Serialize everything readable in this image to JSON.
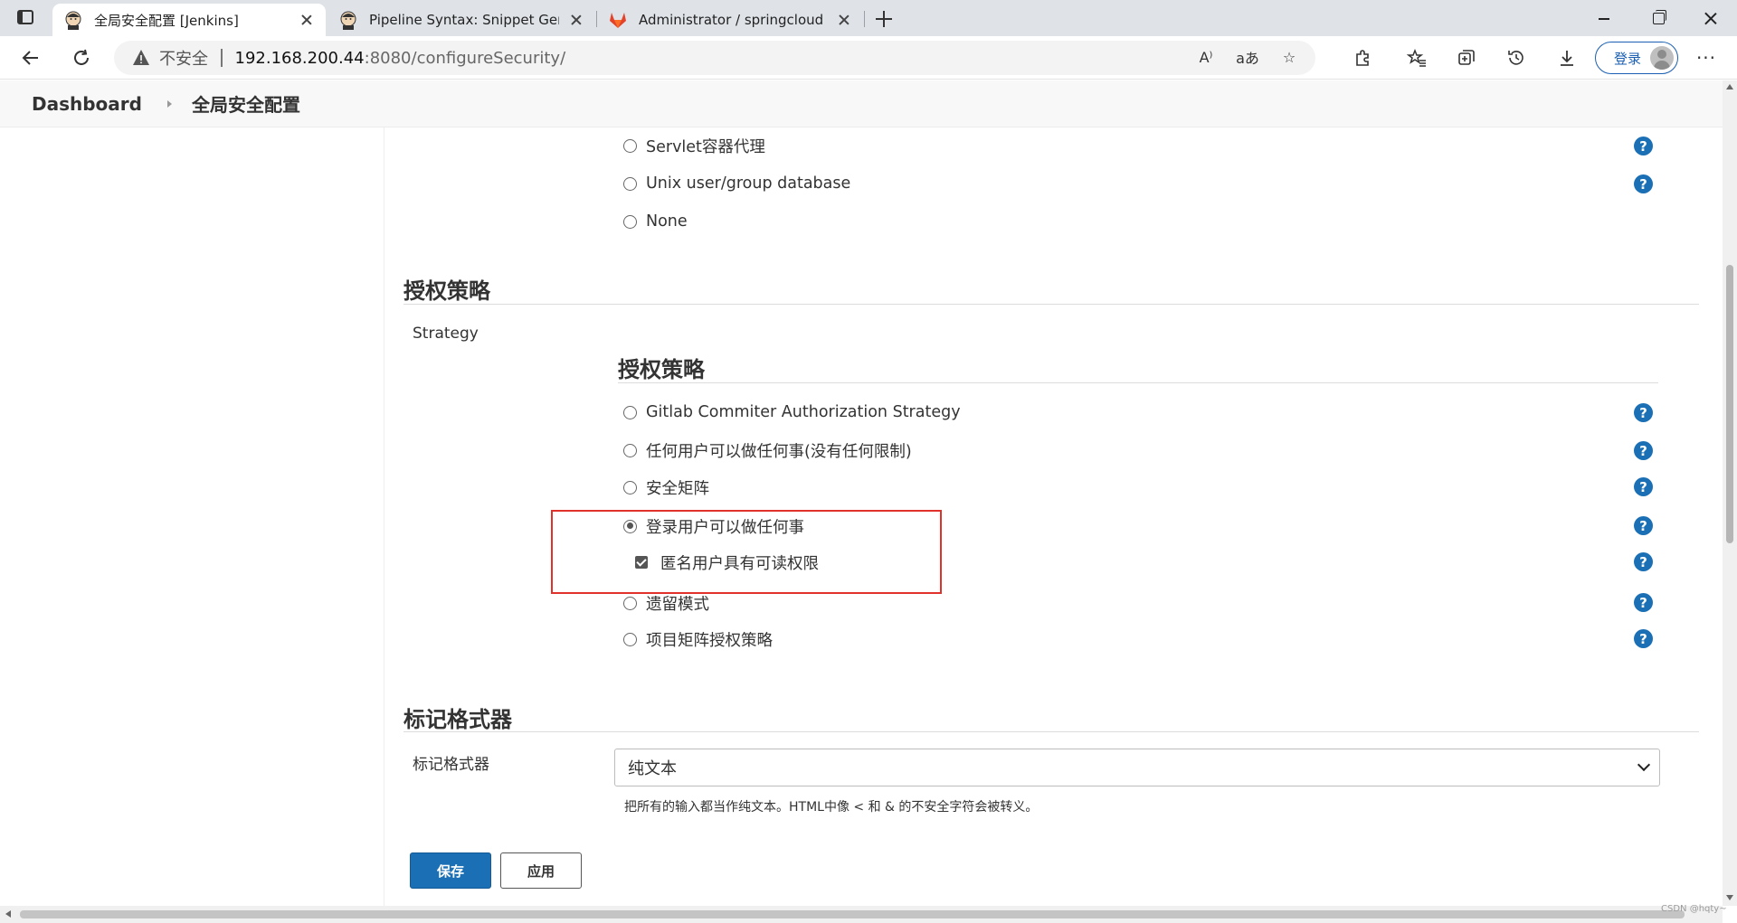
{
  "browser": {
    "tabs": [
      {
        "title": "全局安全配置 [Jenkins]"
      },
      {
        "title": "Pipeline Syntax: Snippet Generator"
      },
      {
        "title": "Administrator / springcloud · GitLab"
      }
    ],
    "address": {
      "insecure_label": "不安全",
      "host": "192.168.200.44",
      "path": ":8080/configureSecurity/"
    },
    "login_label": "登录"
  },
  "breadcrumb": {
    "dashboard": "Dashboard",
    "current": "全局安全配置"
  },
  "security_realm": {
    "options": [
      {
        "label": "Servlet容器代理",
        "selected": false
      },
      {
        "label": "Unix user/group database",
        "selected": false
      },
      {
        "label": "None",
        "selected": false
      }
    ]
  },
  "authorization": {
    "section_title": "授权策略",
    "strategy_label": "Strategy",
    "inner_title": "授权策略",
    "options": [
      {
        "label": "Gitlab Commiter Authorization Strategy",
        "selected": false
      },
      {
        "label": "任何用户可以做任何事(没有任何限制)",
        "selected": false
      },
      {
        "label": "安全矩阵",
        "selected": false
      },
      {
        "label": "登录用户可以做任何事",
        "selected": true
      },
      {
        "label": "遗留模式",
        "selected": false
      },
      {
        "label": "项目矩阵授权策略",
        "selected": false
      }
    ],
    "anonymous_read_label": "匿名用户具有可读权限",
    "anonymous_read_checked": true,
    "help_glyph": "?"
  },
  "markup_formatter": {
    "section_title": "标记格式器",
    "field_label": "标记格式器",
    "selected_value": "纯文本",
    "description": "把所有的输入都当作纯文本。HTML中像 < 和 & 的不安全字符会被转义。"
  },
  "actions": {
    "save_label": "保存",
    "apply_label": "应用"
  },
  "watermark": "CSDN @hqty~",
  "colors": {
    "primary": "#1b6fb5",
    "highlight_box": "#e0312b"
  }
}
